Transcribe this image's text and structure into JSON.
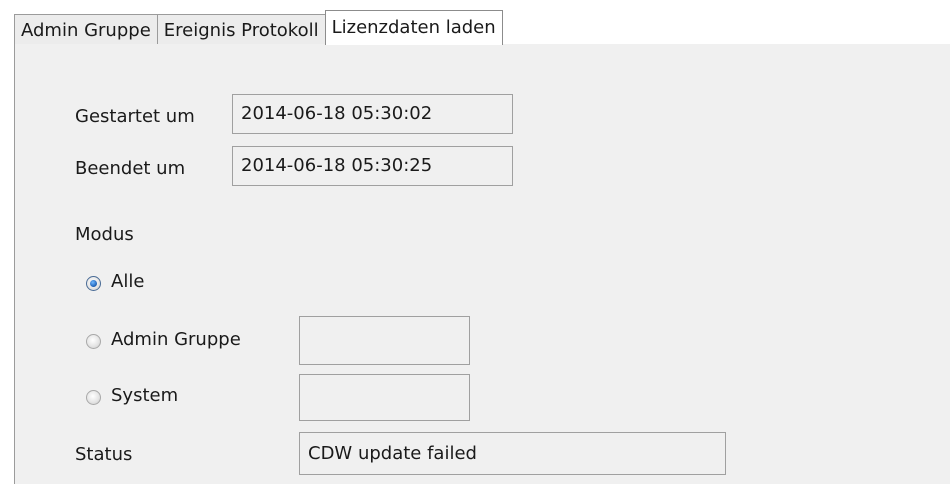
{
  "tabs": [
    {
      "label": "Admin Gruppe",
      "active": false
    },
    {
      "label": "Ereignis Protokoll",
      "active": false
    },
    {
      "label": "Lizenzdaten laden",
      "active": true
    }
  ],
  "form": {
    "started_label": "Gestartet um",
    "started_value": "2014-06-18 05:30:02",
    "ended_label": "Beendet um",
    "ended_value": "2014-06-18 05:30:25",
    "mode_label": "Modus",
    "modes": [
      {
        "label": "Alle",
        "checked": true,
        "value": ""
      },
      {
        "label": "Admin Gruppe",
        "checked": false,
        "value": ""
      },
      {
        "label": "System",
        "checked": false,
        "value": ""
      }
    ],
    "status_label": "Status",
    "status_value": "CDW update failed"
  }
}
